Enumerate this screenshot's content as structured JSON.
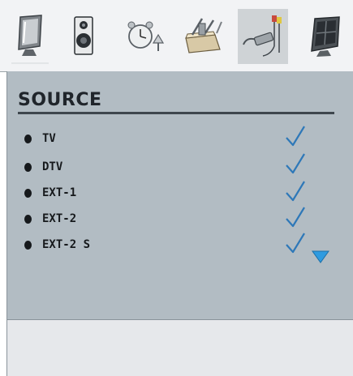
{
  "menu": {
    "tabs": [
      {
        "icon": "monitor-icon"
      },
      {
        "icon": "speaker-icon"
      },
      {
        "icon": "alarm-clock-icon"
      },
      {
        "icon": "toolbox-icon"
      },
      {
        "icon": "av-cable-icon",
        "selected": true
      },
      {
        "icon": "tv-screen-icon"
      }
    ]
  },
  "source": {
    "title": "SOURCE",
    "items": [
      {
        "label": "TV",
        "enabled": true
      },
      {
        "label": "DTV",
        "enabled": true
      },
      {
        "label": "EXT-1",
        "enabled": true
      },
      {
        "label": "EXT-2",
        "enabled": true
      },
      {
        "label": "EXT-2 S",
        "enabled": true
      }
    ],
    "more_indicator": "down-arrow"
  },
  "colors": {
    "panel": "#b2bcc3",
    "check": "#2e78b8",
    "arrow": "#2f9be0",
    "selected_tab": "#cfd3d6"
  }
}
